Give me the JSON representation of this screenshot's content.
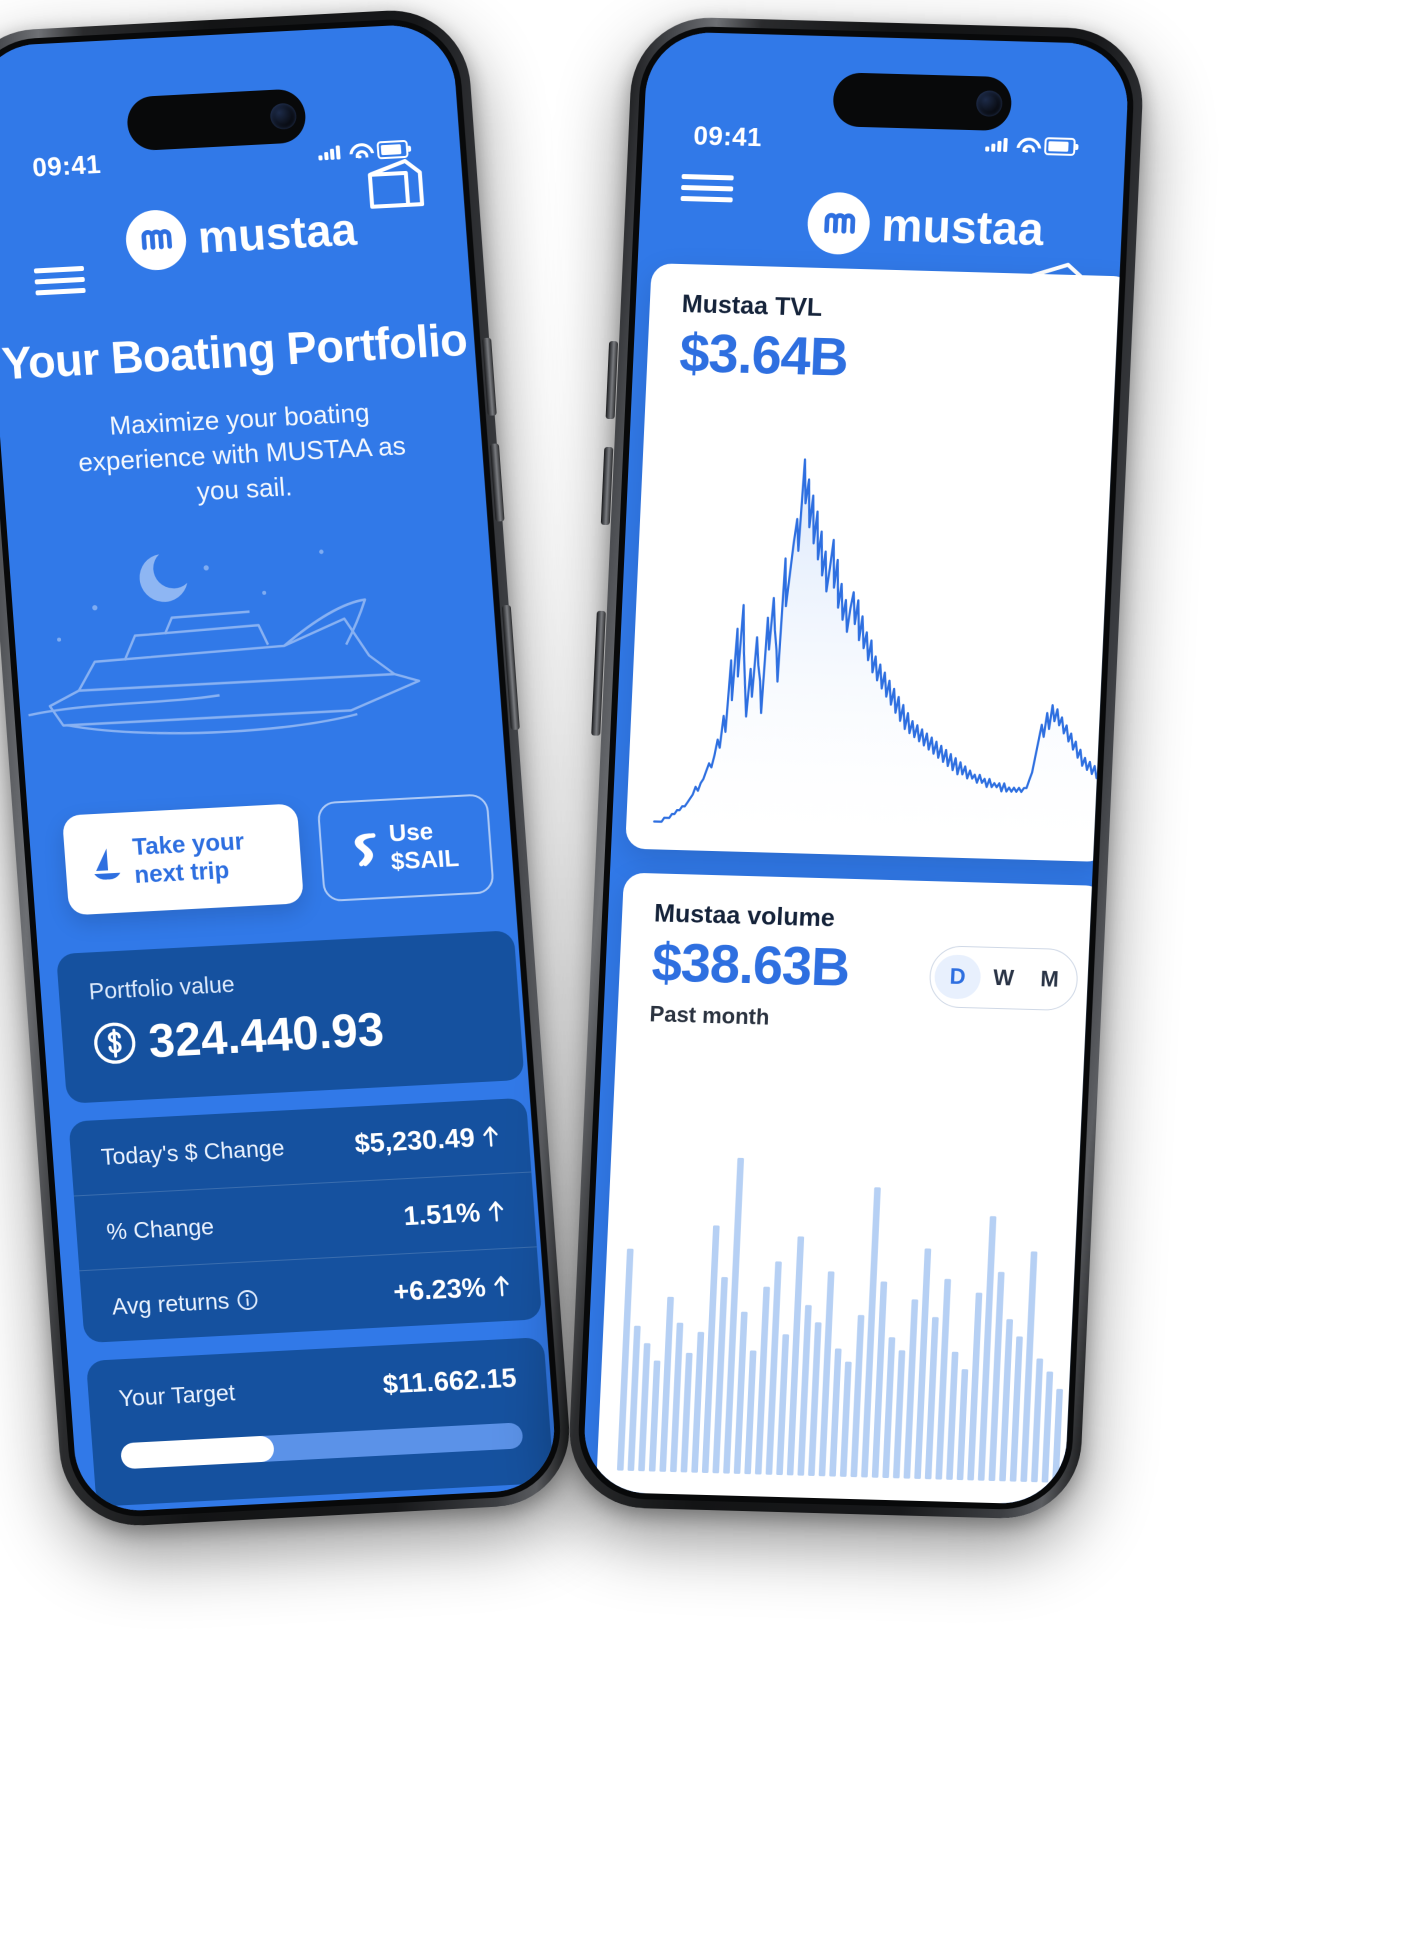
{
  "meta": {
    "brand": "mustaa",
    "accent": "#2E6FE0",
    "screen_bg": "#3179E8",
    "card_dark": "#15519F",
    "chart_line": "#2E6FE0"
  },
  "left_phone": {
    "status": {
      "time": "09:41",
      "signal_icon": "signal-bars-icon",
      "wifi_icon": "wifi-icon",
      "battery_icon": "battery-icon"
    },
    "nav": {
      "menu_icon": "hamburger-menu-icon",
      "logo_icon": "mustaa-logo-icon",
      "brand": "mustaa",
      "wallet_icon": "wallet-icon"
    },
    "hero": {
      "title": "Your Boating Portfolio",
      "subtitle": "Maximize your boating experience with MUSTAA as you sail."
    },
    "illustration": {
      "boat_icon": "sailboat-line-art-icon",
      "moon_icon": "crescent-moon-icon",
      "stars_icon": "sparkle-stars-icon"
    },
    "actions": {
      "primary_label": "Take your next trip",
      "primary_icon": "sailboat-icon",
      "secondary_label": "Use $SAIL",
      "secondary_icon": "sail-token-icon"
    },
    "portfolio": {
      "label": "Portfolio value",
      "value": "324.440.93",
      "currency_icon": "usd-coin-icon"
    },
    "stats": [
      {
        "label": "Today's $ Change",
        "value": "$5,230.49",
        "trend": "up",
        "trend_icon": "arrow-up-icon"
      },
      {
        "label": "% Change",
        "value": "1.51%",
        "trend": "up",
        "trend_icon": "arrow-up-icon"
      },
      {
        "label": "Avg returns",
        "value": "+6.23%",
        "trend": "up",
        "trend_icon": "arrow-up-icon",
        "info_icon": "info-circle-icon"
      }
    ],
    "target": {
      "label": "Your Target",
      "value": "$11.662.15",
      "progress_percent": 38
    }
  },
  "right_phone": {
    "status": {
      "time": "09:41",
      "signal_icon": "signal-bars-icon",
      "wifi_icon": "wifi-icon",
      "battery_icon": "battery-icon"
    },
    "nav": {
      "menu_icon": "hamburger-menu-icon",
      "logo_icon": "mustaa-logo-icon",
      "brand": "mustaa",
      "wallet_icon": "wallet-icon"
    },
    "tvl_card": {
      "label": "Mustaa TVL",
      "value": "$3.64B"
    },
    "volume_card": {
      "label": "Mustaa volume",
      "value": "$38.63B",
      "subtitle": "Past month",
      "range_options": [
        "D",
        "W",
        "M"
      ],
      "range_selected": "D"
    }
  },
  "chart_data": [
    {
      "type": "area",
      "id": "mustaa-tvl-chart",
      "title": "Mustaa TVL",
      "value_label": "$3.64B",
      "xlabel": "",
      "ylabel": "",
      "grid": false,
      "legend": "none",
      "line_color": "#2E6FE0",
      "fill_color": "#d7e5fb",
      "ylim": [
        0,
        100
      ],
      "values": [
        3,
        3,
        3,
        3,
        4,
        4,
        4,
        5,
        5,
        6,
        6,
        7,
        7,
        8,
        9,
        10,
        12,
        11,
        13,
        14,
        16,
        18,
        17,
        20,
        24,
        22,
        30,
        26,
        44,
        34,
        52,
        40,
        58,
        46,
        38,
        30,
        42,
        35,
        50,
        43,
        39,
        31,
        55,
        47,
        60,
        52,
        47,
        39,
        70,
        58,
        66,
        74,
        80,
        72,
        95,
        84,
        90,
        78,
        86,
        74,
        82,
        70,
        77,
        66,
        72,
        62,
        68,
        75,
        63,
        70,
        58,
        64,
        55,
        60,
        52,
        58,
        62,
        54,
        60,
        50,
        56,
        48,
        52,
        45,
        50,
        42,
        46,
        40,
        44,
        38,
        42,
        36,
        40,
        34,
        38,
        32,
        36,
        30,
        34,
        28,
        32,
        27,
        30,
        26,
        29,
        25,
        28,
        24,
        27,
        23,
        26,
        22,
        25,
        21,
        24,
        20,
        23,
        19,
        22,
        18,
        21,
        17,
        20,
        17,
        19,
        16,
        18,
        16,
        17,
        15,
        17,
        15,
        16,
        14,
        16,
        14,
        15,
        14,
        15,
        13,
        15,
        13,
        14,
        13,
        14,
        13,
        14,
        13,
        14,
        14,
        16,
        18,
        22,
        26,
        30,
        27,
        33,
        29,
        35,
        31,
        34,
        30,
        32,
        28,
        30,
        26,
        28,
        24,
        26,
        22,
        24,
        20,
        22,
        19,
        21,
        18,
        20,
        17,
        19,
        17
      ]
    },
    {
      "type": "bar",
      "id": "mustaa-volume-chart",
      "title": "Mustaa volume",
      "value_label": "$38.63B",
      "subtitle": "Past month",
      "xlabel": "",
      "ylabel": "",
      "grid": false,
      "legend": "none",
      "bar_color": "#b6d0f4",
      "ylim": [
        0,
        100
      ],
      "values": [
        52,
        34,
        30,
        26,
        41,
        35,
        28,
        33,
        58,
        46,
        74,
        38,
        29,
        44,
        50,
        33,
        56,
        40,
        36,
        48,
        30,
        27,
        38,
        68,
        46,
        33,
        30,
        42,
        54,
        38,
        47,
        30,
        26,
        44,
        62,
        49,
        38,
        34,
        54,
        29,
        26,
        22
      ]
    }
  ]
}
